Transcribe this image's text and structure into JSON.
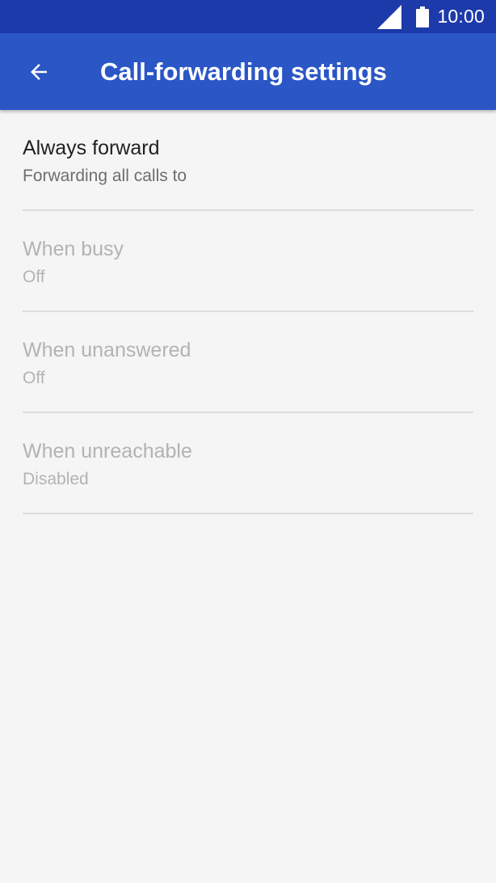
{
  "status_bar": {
    "time": "10:00",
    "icons": [
      "signal-icon",
      "battery-icon"
    ]
  },
  "app_bar": {
    "title": "Call-forwarding settings",
    "back_icon": "arrow-back-icon",
    "color": "#2a56c6"
  },
  "settings": {
    "items": [
      {
        "title": "Always forward",
        "summary": "Forwarding all calls to",
        "enabled": true
      },
      {
        "title": "When busy",
        "summary": "Off",
        "enabled": false
      },
      {
        "title": "When unanswered",
        "summary": "Off",
        "enabled": false
      },
      {
        "title": "When unreachable",
        "summary": "Disabled",
        "enabled": false
      }
    ]
  }
}
